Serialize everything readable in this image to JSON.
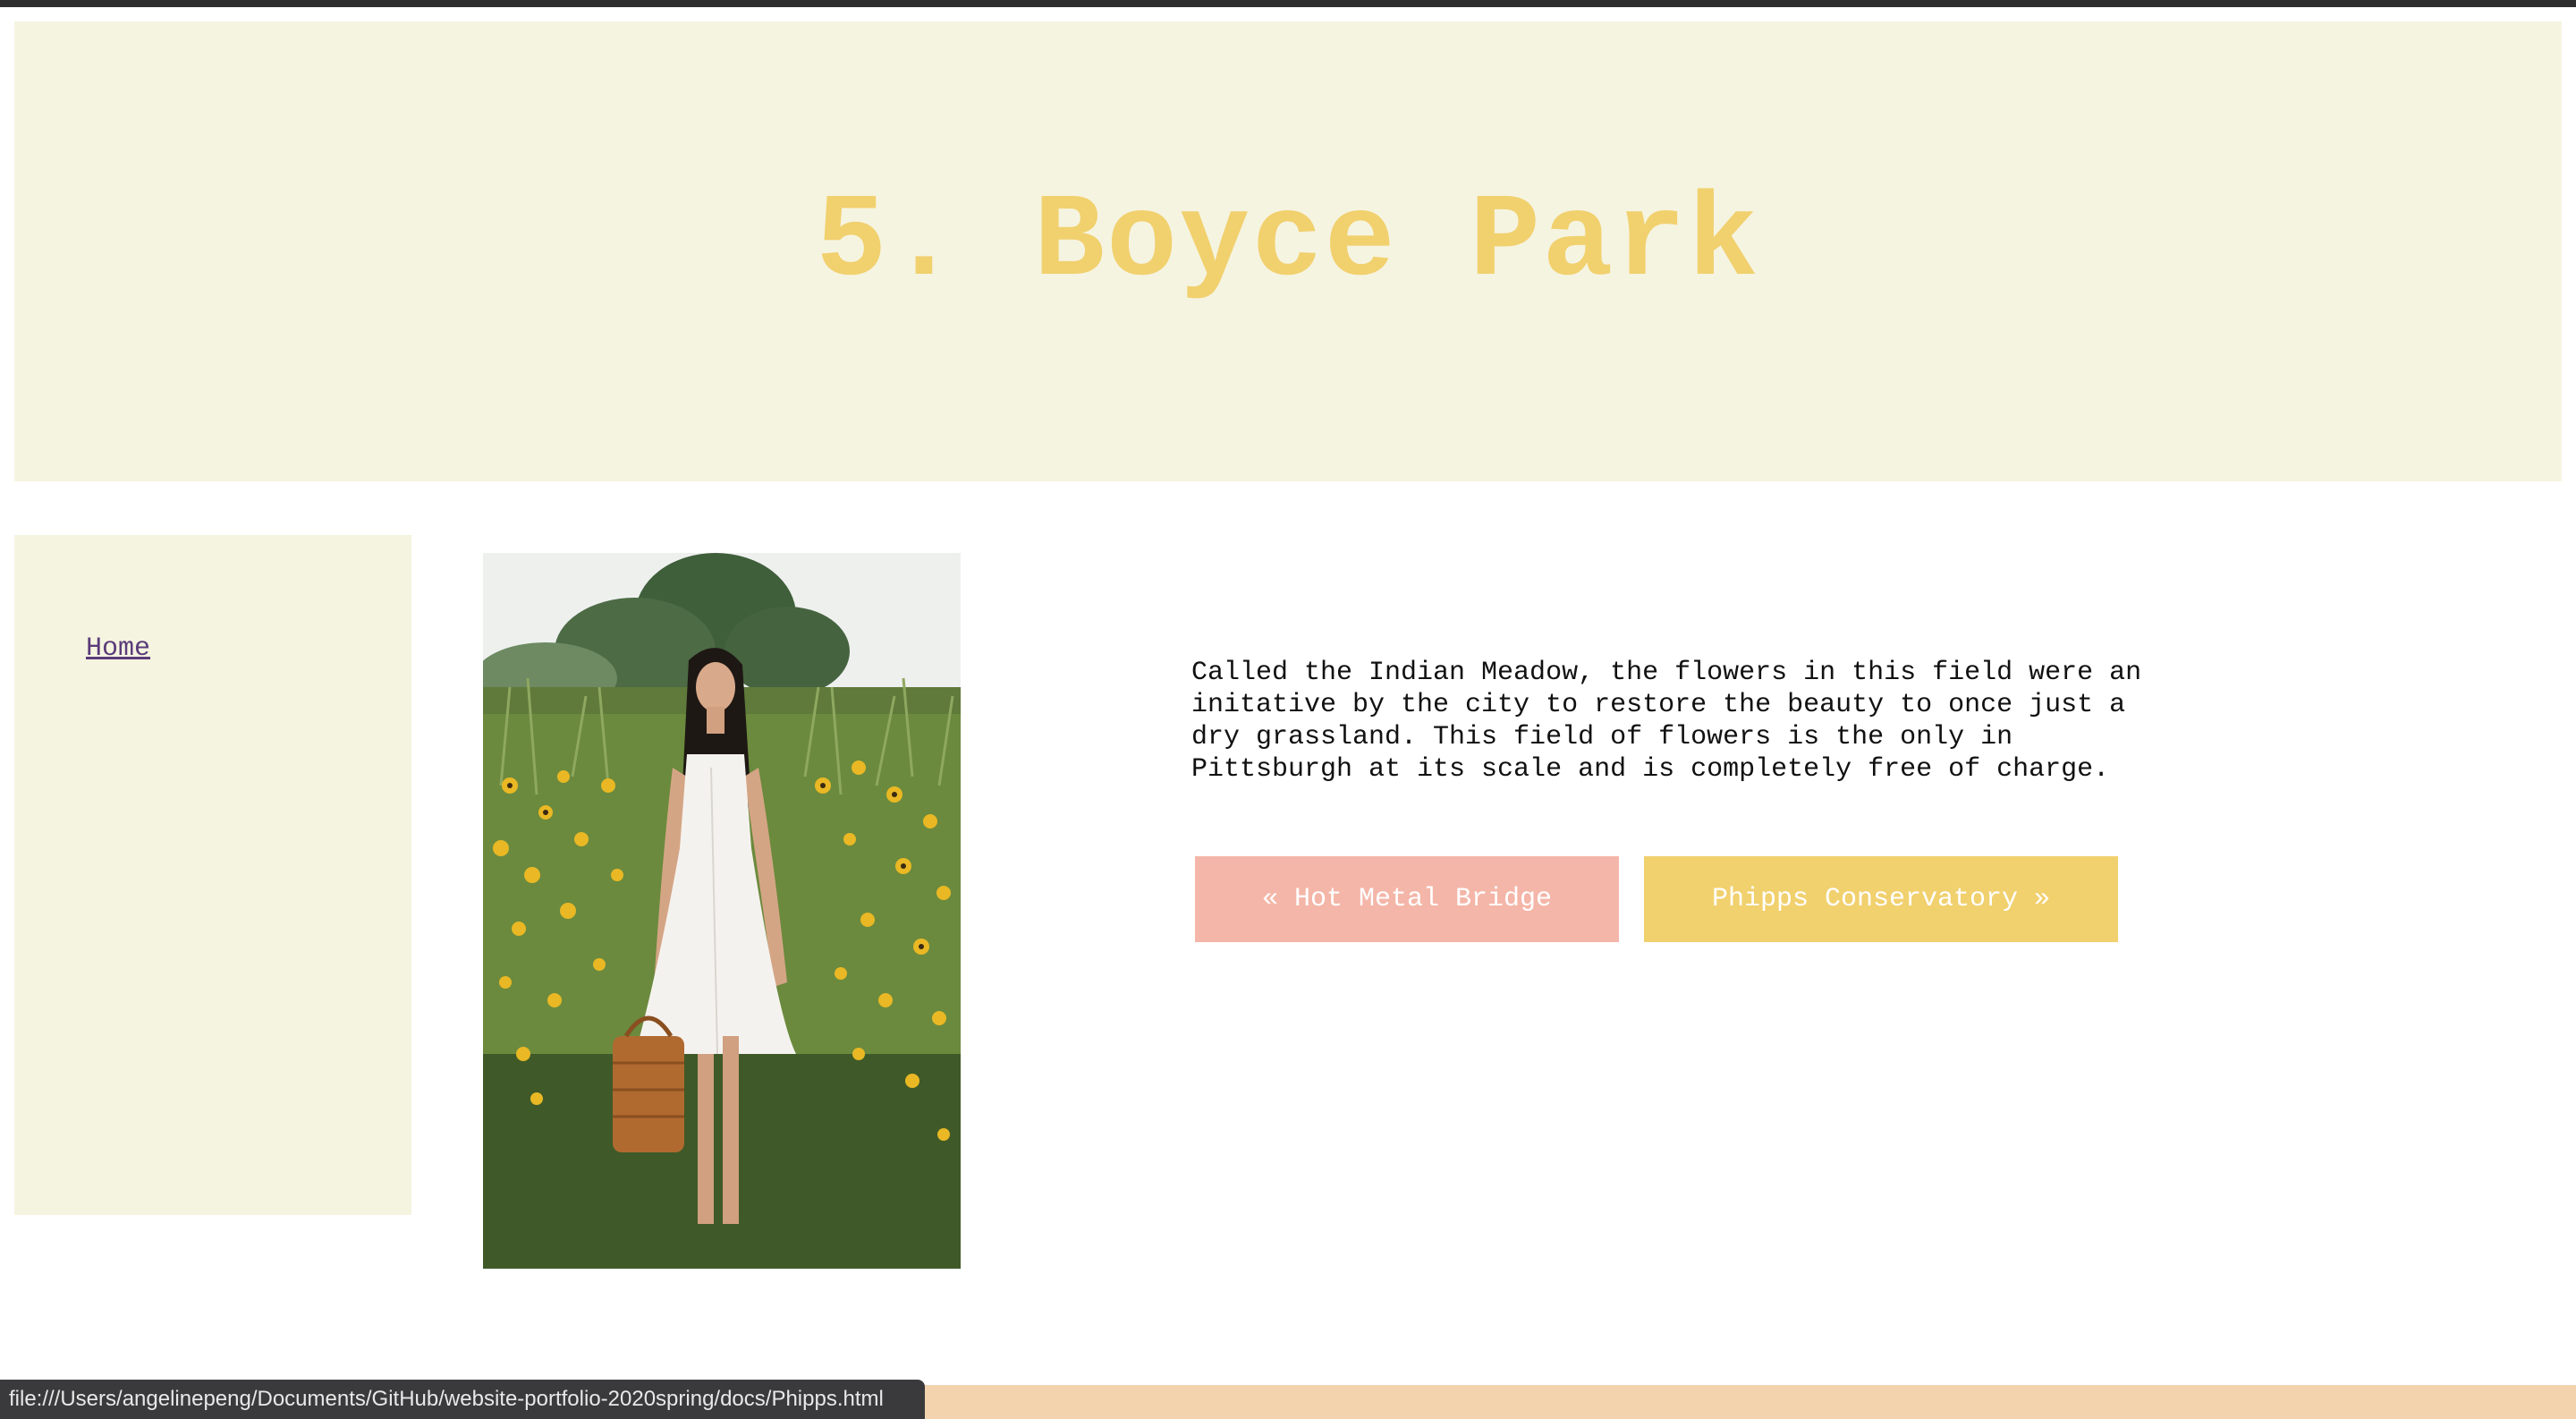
{
  "header": {
    "title": "5. Boyce Park"
  },
  "sidebar": {
    "home_link": "Home"
  },
  "main": {
    "photo_alt": "Woman in white dress standing in field of yellow flowers holding a wicker basket",
    "description": "Called the Indian Meadow, the flowers in this field were an initative by the city to restore the beauty to once just a dry grassland. This field of flowers is the only in Pittsburgh at its scale and is completely free of charge.",
    "prev_button": "« Hot Metal Bridge",
    "next_button": "Phipps Conservatory »"
  },
  "status_bar": {
    "url": "file:///Users/angelinepeng/Documents/GitHub/website-portfolio-2020spring/docs/Phipps.html"
  },
  "colors": {
    "header_bg": "#f5f4e0",
    "title": "#f1d06e",
    "prev_button": "#f4b6a8",
    "next_button": "#f1d06e",
    "footer": "#f2d3ae"
  }
}
